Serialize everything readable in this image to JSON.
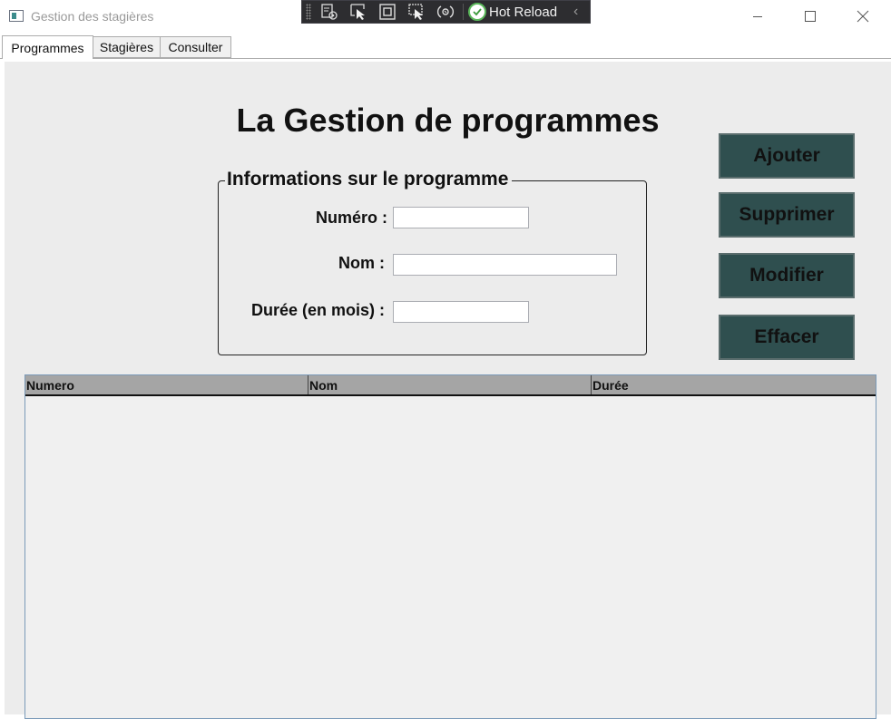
{
  "window": {
    "title": "Gestion des stagières",
    "icon": "app-window-icon"
  },
  "debug_toolbar": {
    "tools": [
      "live-visual-tree-icon",
      "select-element-icon",
      "display-adorners-icon",
      "track-focus-icon",
      "binding-failures-icon"
    ],
    "hot_reload_label": "Hot Reload",
    "hot_reload_status": "ok"
  },
  "tabs": [
    {
      "label": "Programmes",
      "active": true
    },
    {
      "label": "Stagières",
      "active": false
    },
    {
      "label": "Consulter",
      "active": false
    }
  ],
  "page": {
    "title": "La Gestion de programmes"
  },
  "form": {
    "legend": "Informations sur le programme",
    "numero_label": "Numéro :",
    "numero_value": "",
    "nom_label": "Nom :",
    "nom_value": "",
    "duree_label": "Durée (en mois) :",
    "duree_value": ""
  },
  "actions": {
    "ajouter": "Ajouter",
    "supprimer": "Supprimer",
    "modifier": "Modifier",
    "effacer": "Effacer"
  },
  "grid": {
    "columns": [
      "Numero",
      "Nom",
      "Durée"
    ],
    "rows": []
  },
  "colors": {
    "button_background": "#2f4f4f",
    "panel_background": "#ececec",
    "grid_header": "#a5a5a5"
  }
}
